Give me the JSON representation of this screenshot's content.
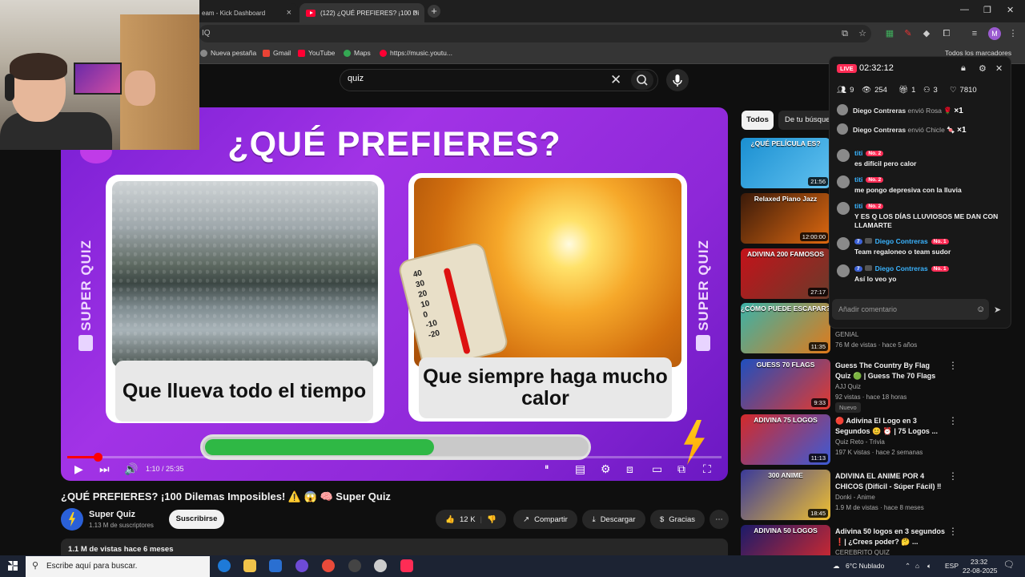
{
  "browser": {
    "tabs": [
      {
        "label": "eam - Kick Dashboard"
      },
      {
        "label": "(122) ¿QUÉ PREFIERES? ¡100 Di"
      }
    ],
    "new_tab": "+",
    "url": "IQ",
    "profile_initial": "M",
    "bookmarks": [
      {
        "label": "Nueva pestaña",
        "icon": "globe-icon"
      },
      {
        "label": "Gmail",
        "icon": "gmail-icon"
      },
      {
        "label": "YouTube",
        "icon": "youtube-icon"
      },
      {
        "label": "Maps",
        "icon": "maps-icon"
      },
      {
        "label": "https://music.youtu...",
        "icon": "music-icon"
      }
    ],
    "all_bookmarks": "Todos los marcadores"
  },
  "youtube": {
    "search_query": "quiz",
    "video": {
      "thumb_title": "¿QUÉ PREFIERES?",
      "side_label": "SUPER QUIZ",
      "option_left": "Que llueva todo el tiempo",
      "option_right": "Que siempre haga mucho calor",
      "thermometer_numbers": "40\n30\n20\n10\n0\n-10\n-20",
      "progress": 0.6,
      "played_fraction": 0.047,
      "time": "1:10 / 25:35"
    },
    "title": "¿QUÉ PREFIERES? ¡100 Dilemas Imposibles! ⚠️ 😱 🧠 Super Quiz",
    "channel": {
      "name": "Super Quiz",
      "subscribers": "1.13 M de suscriptores",
      "subscribe_label": "Suscribirse"
    },
    "actions": {
      "likes": "12 K",
      "share": "Compartir",
      "download": "Descargar",
      "thanks": "Gracias",
      "more": "⋯"
    },
    "description_meta": "1.1 M de vistas  hace 6 meses",
    "chips": [
      "Todos",
      "De tu búsqueda"
    ],
    "related": [
      {
        "caption": "¿QUÉ PELÍCULA ES?",
        "duration": "21:56",
        "colors": [
          "#1a8fd1",
          "#62c2f0"
        ]
      },
      {
        "caption": "Relaxed Piano Jazz",
        "duration": "12:00:00",
        "colors": [
          "#3a1a0a",
          "#e06a10"
        ]
      },
      {
        "caption": "ADIVINA 200 FAMOSOS",
        "duration": "27:17",
        "colors": [
          "#c4121a",
          "#6a3b2a"
        ]
      },
      {
        "caption": "¿CÓMO PUEDE ESCAPAR?",
        "duration": "11:35",
        "colors": [
          "#3bb2a8",
          "#e07a1a"
        ],
        "channel": "GENIAL",
        "meta": "76 M de vistas · hace 5 años"
      },
      {
        "caption": "GUESS 70 FLAGS",
        "duration": "9:33",
        "colors": [
          "#1f4fbf",
          "#e23a2f"
        ],
        "title": "Guess The Country By Flag Quiz 🟢 | Guess The 70 Flags",
        "channel": "AJJ Quiz",
        "meta": "92 vistas · hace 18 horas",
        "badge": "Nuevo"
      },
      {
        "caption": "ADIVINA 75 LOGOS",
        "duration": "11:13",
        "colors": [
          "#d42a2a",
          "#3b5bd6"
        ],
        "title": "🔴 Adivina El Logo en 3 Segundos 😊 ⏰ | 75 Logos ...",
        "channel": "Quiz Reto - Trivia",
        "meta": "197 K vistas · hace 2 semanas"
      },
      {
        "caption": "300 ANIME",
        "duration": "18:45",
        "colors": [
          "#3a3a9a",
          "#f0c030"
        ],
        "title": "ADIVINA EL ANIME POR 4 CHICOS (Difícil - Súper Fácil) ‼",
        "channel": "Donki - Anime",
        "meta": "1.9 M de vistas · hace 8 meses"
      },
      {
        "caption": "ADIVINA 50 LOGOS",
        "duration": "",
        "colors": [
          "#1b1b6a",
          "#e02a2a"
        ],
        "title": "Adivina 50 logos en 3 segundos ❗| ¿Crees poder? 🤔 ...",
        "channel": "CEREBRITO QUIZ",
        "meta": ""
      }
    ]
  },
  "live": {
    "badge": "LIVE",
    "timer": "02:32:12",
    "stats": [
      {
        "icon": "people-icon",
        "value": "9"
      },
      {
        "icon": "eye-icon",
        "value": "254"
      },
      {
        "icon": "gift-icon",
        "value": "1"
      },
      {
        "icon": "users-icon",
        "value": "3"
      },
      {
        "icon": "heart-icon",
        "value": "7810"
      }
    ],
    "gifts": [
      {
        "user": "Diego Contreras",
        "text": "envió Rosa",
        "emoji": "🌹",
        "count": "×1"
      },
      {
        "user": "Diego Contreras",
        "text": "envió Chicle",
        "emoji": "🍬",
        "count": "×1"
      }
    ],
    "messages": [
      {
        "user": "titi",
        "badge": "No. 2",
        "level": "",
        "text": "es difícil pero calor"
      },
      {
        "user": "titi",
        "badge": "No. 2",
        "level": "",
        "text": "me pongo depresiva con la lluvia"
      },
      {
        "user": "titi",
        "badge": "No. 2",
        "level": "",
        "text": "Y ES Q LOS DÍAS LLUVIOSOS ME DAN CON LLAMARTE"
      },
      {
        "user": "Diego Contreras",
        "badge": "No. 1",
        "level": "7",
        "text": "Team regaloneo o team sudor"
      },
      {
        "user": "Diego Contreras",
        "badge": "No. 1",
        "level": "7",
        "text": "Así lo veo yo"
      }
    ],
    "comment_placeholder": "Añadir comentario"
  },
  "taskbar": {
    "search_placeholder": "Escribe aquí para buscar.",
    "weather": "6°C  Nublado",
    "lang": "ESP",
    "time": "23:32",
    "date": "22-08-2025"
  }
}
